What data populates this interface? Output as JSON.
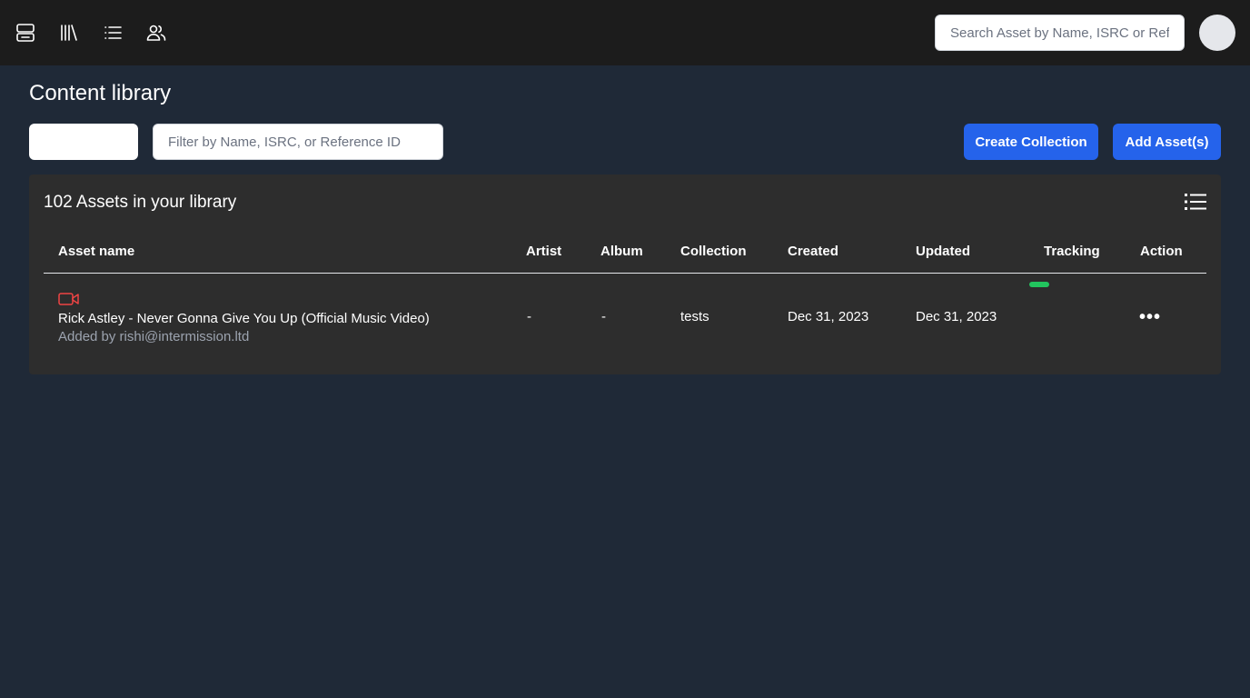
{
  "nav": {
    "icons": [
      "dashboard-icon",
      "library-icon",
      "list-icon",
      "users-icon"
    ]
  },
  "search": {
    "placeholder": "Search Asset by Name, ISRC or Reference ID"
  },
  "page": {
    "title": "Content library"
  },
  "toolbar": {
    "filter_placeholder": "Filter by Name, ISRC, or Reference ID",
    "create_collection_label": "Create Collection",
    "add_assets_label": "Add Asset(s)"
  },
  "library": {
    "count_label": "102 Assets in your library",
    "columns": {
      "asset_name": "Asset name",
      "artist": "Artist",
      "album": "Album",
      "collection": "Collection",
      "created": "Created",
      "updated": "Updated",
      "tracking": "Tracking",
      "action": "Action"
    },
    "rows": [
      {
        "type_icon": "video-camera-icon",
        "name": "Rick Astley - Never Gonna Give You Up (Official Music Video)",
        "added_by": "Added by rishi@intermission.ltd",
        "artist": "-",
        "album": "-",
        "collection": "tests",
        "created": "Dec 31, 2023",
        "updated": "Dec 31, 2023",
        "tracking_color": "#22c55e",
        "action_label": "•••"
      }
    ]
  },
  "colors": {
    "background": "#1f2937",
    "topbar": "#1c1c1c",
    "panel": "#2d2d2d",
    "accent": "#2563eb",
    "tracking_active": "#22c55e",
    "video_icon": "#ef4444"
  }
}
